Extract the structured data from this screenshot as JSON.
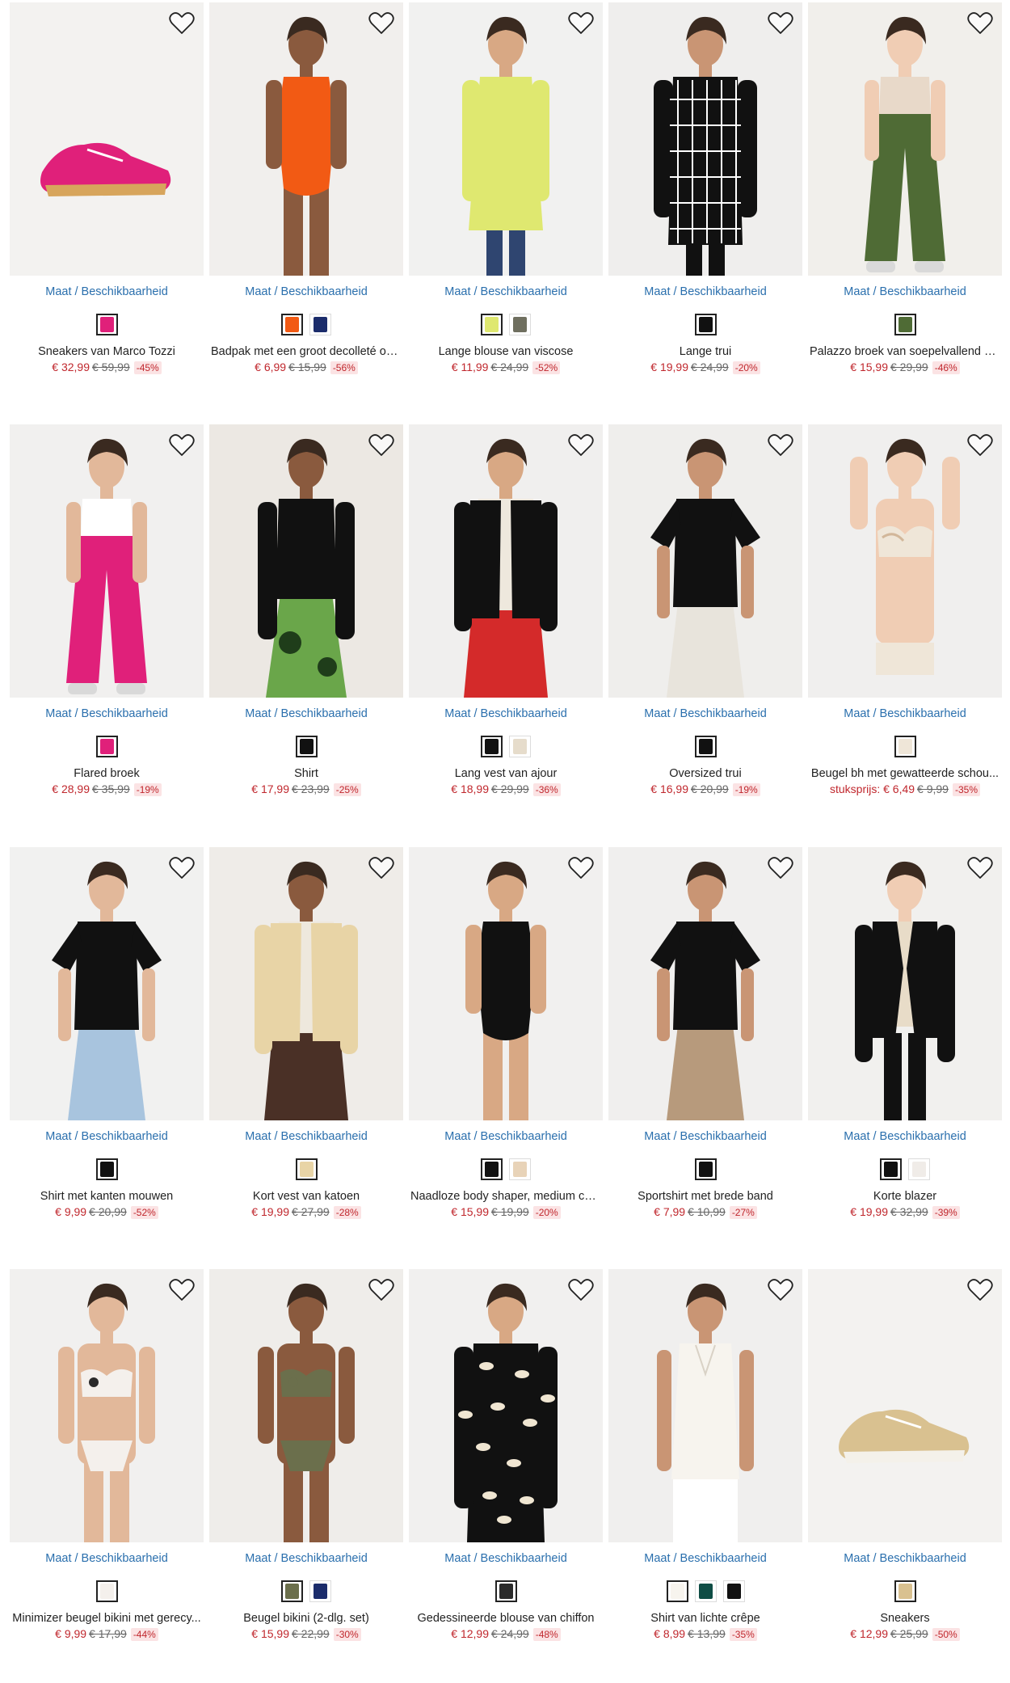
{
  "size_link": "Maat / Beschikbaarheid",
  "products": [
    {
      "name": "Sneakers van Marco Tozzi",
      "price": "€ 32,99",
      "old": "€ 59,99",
      "disc": "-45%",
      "bg": "#f3f2f0",
      "kind": "shoe",
      "c1": "#e0207a",
      "c2": "#d7a55c",
      "sw": [
        "#e0207a"
      ]
    },
    {
      "name": "Badpak met een groot decolleté op...",
      "price": "€ 6,99",
      "old": "€ 15,99",
      "disc": "-56%",
      "bg": "#f1efed",
      "kind": "swimsuit",
      "c1": "#f25a14",
      "c2": "#d9a58a",
      "sw": [
        "#f25a14",
        "#1b2c6b"
      ]
    },
    {
      "name": "Lange blouse van viscose",
      "price": "€ 11,99",
      "old": "€ 24,99",
      "disc": "-52%",
      "bg": "#f1f1f0",
      "kind": "longtop",
      "c1": "#dfe870",
      "c2": "#2f4570",
      "sw": [
        "#dfe870",
        "#6f6f5f"
      ]
    },
    {
      "name": "Lange trui",
      "price": "€ 19,99",
      "old": "€ 24,99",
      "disc": "-20%",
      "bg": "#efeeed",
      "kind": "grid",
      "c1": "#111111",
      "c2": "#ffffff",
      "sw": [
        "#111111"
      ]
    },
    {
      "name": "Palazzo broek van soepelvallend sa...",
      "price": "€ 15,99",
      "old": "€ 29,99",
      "disc": "-46%",
      "bg": "#f1efeb",
      "kind": "pants",
      "c1": "#4f6b35",
      "c2": "#e8d9c9",
      "sw": [
        "#4f6b35"
      ]
    },
    {
      "name": "Flared broek",
      "price": "€ 28,99",
      "old": "€ 35,99",
      "disc": "-19%",
      "bg": "#f1f0ef",
      "kind": "pants",
      "c1": "#e0207a",
      "c2": "#ffffff",
      "sw": [
        "#e0207a"
      ]
    },
    {
      "name": "Shirt",
      "price": "€ 17,99",
      "old": "€ 23,99",
      "disc": "-25%",
      "bg": "#ece8e3",
      "kind": "longsleeve",
      "c1": "#111111",
      "c2": "#6aa64a",
      "sw": [
        "#111111"
      ]
    },
    {
      "name": "Lang vest van ajour",
      "price": "€ 18,99",
      "old": "€ 29,99",
      "disc": "-36%",
      "bg": "#f0efee",
      "kind": "cardigan",
      "c1": "#111111",
      "c2": "#d42a2a",
      "sw": [
        "#111111",
        "#e6dccb"
      ]
    },
    {
      "name": "Oversized trui",
      "price": "€ 16,99",
      "old": "€ 20,99",
      "disc": "-19%",
      "bg": "#efeeec",
      "kind": "tee",
      "c1": "#111111",
      "c2": "#e8e4dc",
      "sw": [
        "#111111"
      ]
    },
    {
      "name": "Beugel bh met gewatteerde schou...",
      "price": "stuksprijs: € 6,49",
      "old": "€ 9,99",
      "disc": "-35%",
      "bg": "#f0efee",
      "kind": "bra",
      "c1": "#efe6d8",
      "c2": "#d2b79a",
      "sw": [
        "#efe6d8"
      ]
    },
    {
      "name": "Shirt met kanten mouwen",
      "price": "€ 9,99",
      "old": "€ 20,99",
      "disc": "-52%",
      "bg": "#f1f1f0",
      "kind": "tee",
      "c1": "#111111",
      "c2": "#a8c4de",
      "sw": [
        "#111111"
      ]
    },
    {
      "name": "Kort vest van katoen",
      "price": "€ 19,99",
      "old": "€ 27,99",
      "disc": "-28%",
      "bg": "#efece8",
      "kind": "cardigan",
      "c1": "#e8d4a6",
      "c2": "#4a3026",
      "sw": [
        "#e8d4a6"
      ]
    },
    {
      "name": "Naadloze body shaper, medium corr...",
      "price": "€ 15,99",
      "old": "€ 19,99",
      "disc": "-20%",
      "bg": "#f1f0ef",
      "kind": "swimsuit",
      "c1": "#111111",
      "c2": "#c99a7c",
      "sw": [
        "#111111",
        "#e8d3b8"
      ]
    },
    {
      "name": "Sportshirt met brede band",
      "price": "€ 7,99",
      "old": "€ 10,99",
      "disc": "-27%",
      "bg": "#f0efee",
      "kind": "tee",
      "c1": "#111111",
      "c2": "#b79a7c",
      "sw": [
        "#111111"
      ]
    },
    {
      "name": "Korte blazer",
      "price": "€ 19,99",
      "old": "€ 32,99",
      "disc": "-39%",
      "bg": "#f1f0ee",
      "kind": "blazer",
      "c1": "#111111",
      "c2": "#e8dcc8",
      "sw": [
        "#111111",
        "#f0ece8"
      ]
    },
    {
      "name": "Minimizer beugel bikini met gerecy...",
      "price": "€ 9,99",
      "old": "€ 17,99",
      "disc": "-44%",
      "bg": "#f1f0ef",
      "kind": "bikini",
      "c1": "#2a2a2a",
      "c2": "#f4f0ec",
      "sw": [
        "#f4f0ec"
      ]
    },
    {
      "name": "Beugel bikini (2-dlg. set)",
      "price": "€ 15,99",
      "old": "€ 22,99",
      "disc": "-30%",
      "bg": "#efedea",
      "kind": "bikini",
      "c1": "#6b6f4c",
      "c2": "#c98e6a",
      "sw": [
        "#6b6f4c",
        "#1b2c6b"
      ]
    },
    {
      "name": "Gedessineerde blouse van chiffon",
      "price": "€ 12,99",
      "old": "€ 24,99",
      "disc": "-48%",
      "bg": "#f1f0ef",
      "kind": "printblouse",
      "c1": "#111111",
      "c2": "#f0e6d2",
      "sw": [
        "#2a2a2a"
      ]
    },
    {
      "name": "Shirt van lichte crêpe",
      "price": "€ 8,99",
      "old": "€ 13,99",
      "disc": "-35%",
      "bg": "#f0efee",
      "kind": "tank",
      "c1": "#f7f4ee",
      "c2": "#efe9e0",
      "sw": [
        "#f7f4ee",
        "#0f4d45",
        "#111111"
      ]
    },
    {
      "name": "Sneakers",
      "price": "€ 12,99",
      "old": "€ 25,99",
      "disc": "-50%",
      "bg": "#f3f2f0",
      "kind": "shoe",
      "c1": "#d9c190",
      "c2": "#f4f1ea",
      "sw": [
        "#d9c190"
      ]
    }
  ]
}
